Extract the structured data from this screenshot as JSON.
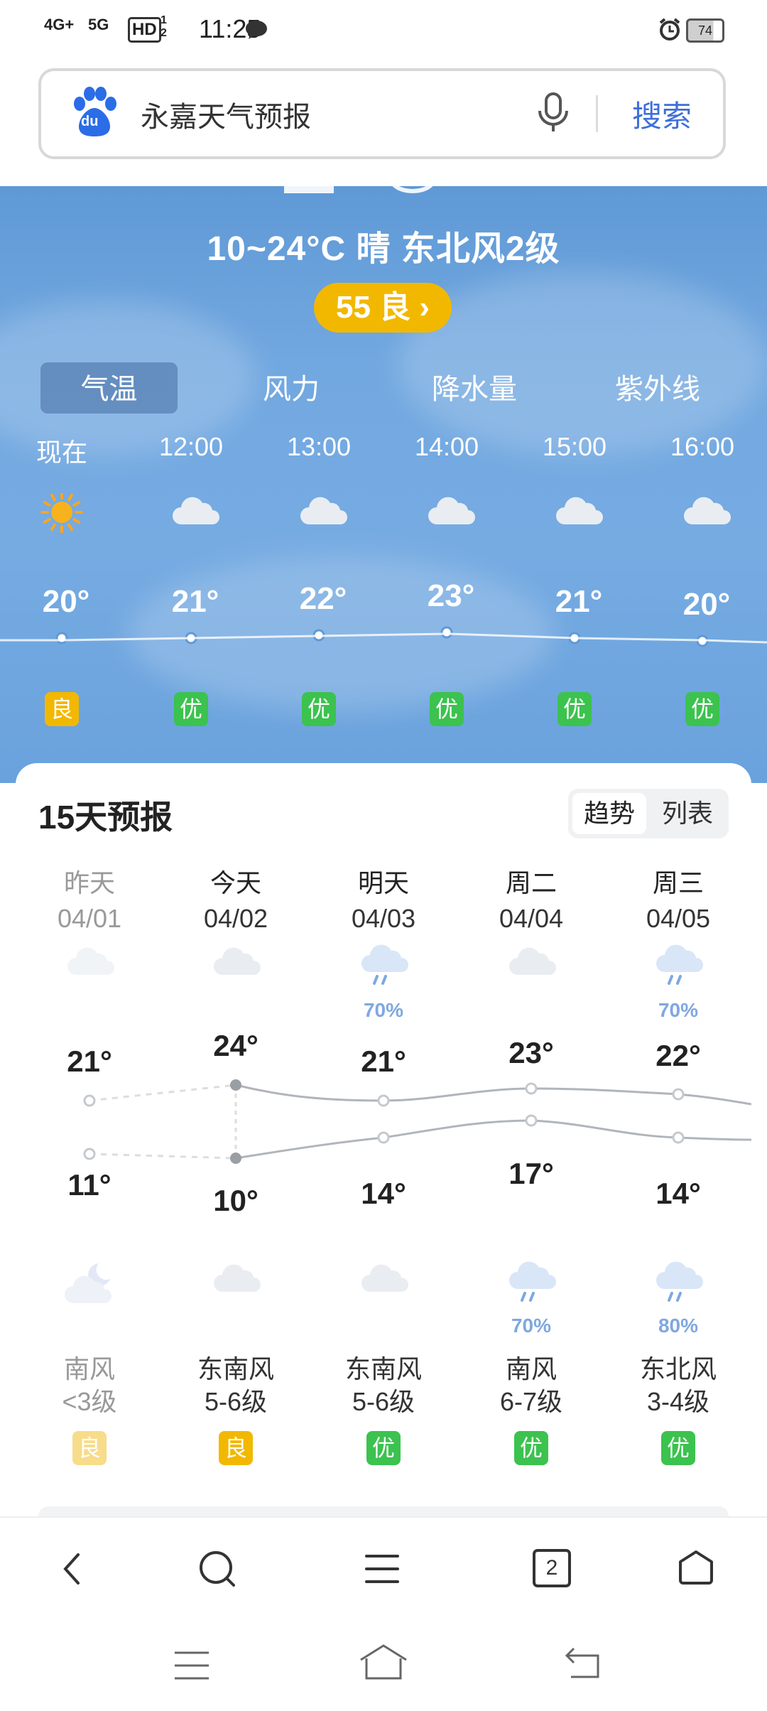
{
  "status": {
    "net1": "4G+",
    "net2": "5G",
    "hd": "HD",
    "hd_sub": "1 2",
    "time": "11:25",
    "battery": "74"
  },
  "search": {
    "query": "永嘉天气预报",
    "button": "搜索",
    "logo": "du"
  },
  "current": {
    "summary": "10~24°C  晴  东北风2级",
    "aqi": "55 良"
  },
  "tabs": [
    "气温",
    "风力",
    "降水量",
    "紫外线"
  ],
  "hourly": [
    {
      "time": "现在",
      "icon": "sun-icon",
      "temp": "20°",
      "aqi": "良",
      "aqi_color": "#f2b800"
    },
    {
      "time": "12:00",
      "icon": "cloud-icon",
      "temp": "21°",
      "aqi": "优",
      "aqi_color": "#3cc24e"
    },
    {
      "time": "13:00",
      "icon": "cloud-icon",
      "temp": "22°",
      "aqi": "优",
      "aqi_color": "#3cc24e"
    },
    {
      "time": "14:00",
      "icon": "cloud-icon",
      "temp": "23°",
      "aqi": "优",
      "aqi_color": "#3cc24e"
    },
    {
      "time": "15:00",
      "icon": "cloud-icon",
      "temp": "21°",
      "aqi": "优",
      "aqi_color": "#3cc24e"
    },
    {
      "time": "16:00",
      "icon": "cloud-icon",
      "temp": "20°",
      "aqi": "优",
      "aqi_color": "#3cc24e"
    }
  ],
  "forecast": {
    "title": "15天预报",
    "toggle": [
      "趋势",
      "列表"
    ],
    "days": [
      {
        "name": "昨天",
        "date": "04/01",
        "day_icon": "cloud-icon",
        "day_rain": "",
        "hi": "21°",
        "lo": "11°",
        "night_icon": "moon-cloud-icon",
        "night_rain": "",
        "wind_dir": "南风",
        "wind_lvl": "<3级",
        "aqi": "良",
        "aqi_color": "#f7dc8a",
        "past": true
      },
      {
        "name": "今天",
        "date": "04/02",
        "day_icon": "cloud-icon",
        "day_rain": "",
        "hi": "24°",
        "lo": "10°",
        "night_icon": "cloud-icon",
        "night_rain": "",
        "wind_dir": "东南风",
        "wind_lvl": "5-6级",
        "aqi": "良",
        "aqi_color": "#f2b800",
        "past": false
      },
      {
        "name": "明天",
        "date": "04/03",
        "day_icon": "rain-cloud-icon",
        "day_rain": "70%",
        "hi": "21°",
        "lo": "14°",
        "night_icon": "cloud-icon",
        "night_rain": "",
        "wind_dir": "东南风",
        "wind_lvl": "5-6级",
        "aqi": "优",
        "aqi_color": "#3cc24e",
        "past": false
      },
      {
        "name": "周二",
        "date": "04/04",
        "day_icon": "cloud-icon",
        "day_rain": "",
        "hi": "23°",
        "lo": "17°",
        "night_icon": "rain-cloud-icon",
        "night_rain": "70%",
        "wind_dir": "南风",
        "wind_lvl": "6-7级",
        "aqi": "优",
        "aqi_color": "#3cc24e",
        "past": false
      },
      {
        "name": "周三",
        "date": "04/05",
        "day_icon": "rain-cloud-icon",
        "day_rain": "70%",
        "hi": "22°",
        "lo": "14°",
        "night_icon": "rain-cloud-icon",
        "night_rain": "80%",
        "wind_dir": "东北风",
        "wind_lvl": "3-4级",
        "aqi": "优",
        "aqi_color": "#3cc24e",
        "past": false
      }
    ]
  },
  "nav": {
    "tab_count": "2"
  }
}
